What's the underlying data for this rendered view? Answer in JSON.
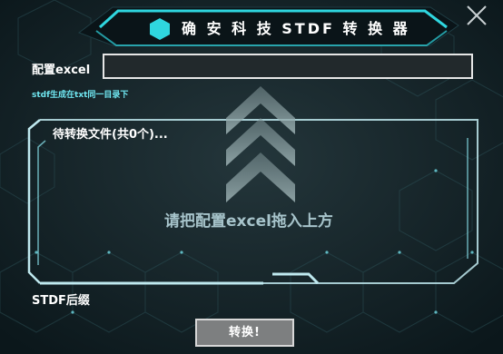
{
  "window": {
    "title": "确 安 科 技 STDF 转 换 器",
    "close_icon": "close-icon"
  },
  "config": {
    "excel_label": "配置excel",
    "excel_value": "",
    "hint": "stdf生成在txt同一目录下"
  },
  "files": {
    "list_title": "待转换文件(共0个)...",
    "drop_hint": "请把配置excel拖入上方"
  },
  "suffix": {
    "label": "STDF后缀"
  },
  "actions": {
    "convert_label": "转换!"
  },
  "colors": {
    "accent": "#2fd6df",
    "background": "#0d1a1f",
    "panel_border": "#bfe9ef"
  }
}
